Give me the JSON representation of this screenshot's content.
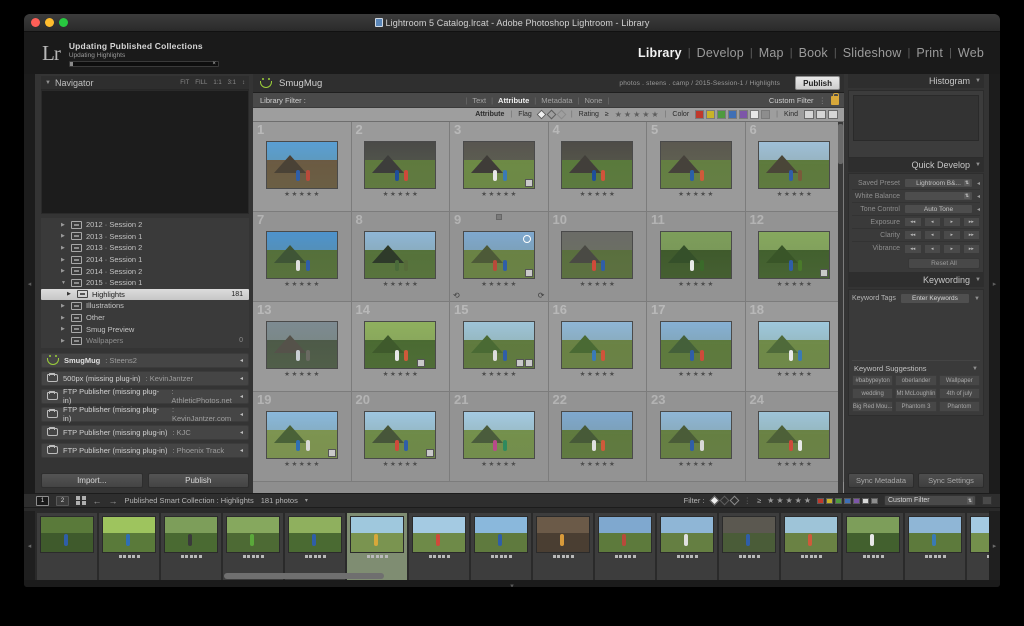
{
  "window": {
    "title": "Lightroom 5 Catalog.lrcat - Adobe Photoshop Lightroom - Library",
    "traffic": [
      "close",
      "minimize",
      "maximize"
    ]
  },
  "header": {
    "logo": "Lr",
    "progress": {
      "title": "Updating Published Collections",
      "subtitle": "Updating Highlights",
      "cancel": "×",
      "percent": 3
    },
    "modules": [
      {
        "label": "Library",
        "active": true
      },
      {
        "label": "Develop",
        "active": false
      },
      {
        "label": "Map",
        "active": false
      },
      {
        "label": "Book",
        "active": false
      },
      {
        "label": "Slideshow",
        "active": false
      },
      {
        "label": "Print",
        "active": false
      },
      {
        "label": "Web",
        "active": false
      }
    ],
    "separator": "|"
  },
  "left_panel": {
    "navigator": {
      "title": "Navigator",
      "zoom_levels": [
        "FIT",
        "FILL",
        "1:1",
        "3:1"
      ],
      "caret": "↕"
    },
    "tree": [
      {
        "label": "2012 · Session 2",
        "count": "",
        "selected": false
      },
      {
        "label": "2013 · Session 1",
        "count": "",
        "selected": false
      },
      {
        "label": "2013 · Session 2",
        "count": "",
        "selected": false
      },
      {
        "label": "2014 · Session 1",
        "count": "",
        "selected": false
      },
      {
        "label": "2014 · Session 2",
        "count": "",
        "selected": false
      },
      {
        "label": "2015 · Session 1",
        "count": "",
        "selected": false,
        "expanded": true
      },
      {
        "label": "Highlights",
        "count": "181",
        "selected": true,
        "child": true
      },
      {
        "label": "Illustrations",
        "count": "",
        "selected": false
      },
      {
        "label": "Other",
        "count": "",
        "selected": false
      },
      {
        "label": "Smug Preview",
        "count": "",
        "selected": false
      },
      {
        "label": "Wallpapers",
        "count": "0",
        "selected": false,
        "dim": true
      }
    ],
    "publish_services": [
      {
        "name": "SmugMug",
        "account": "Steens2",
        "icon": "smugmug-icon",
        "active": true
      },
      {
        "name": "500px (missing plug-in)",
        "account": "KevinJantzer",
        "icon": "folder-icon"
      },
      {
        "name": "FTP Publisher (missing plug-in)",
        "account": "AthleticPhotos.net",
        "icon": "folder-icon"
      },
      {
        "name": "FTP Publisher (missing plug-in)",
        "account": "KevinJantzer.com",
        "icon": "folder-icon"
      },
      {
        "name": "FTP Publisher (missing plug-in)",
        "account": "KJC",
        "icon": "folder-icon"
      },
      {
        "name": "FTP Publisher (missing plug-in)",
        "account": "Phoenix Track",
        "icon": "folder-icon"
      }
    ],
    "buttons": {
      "import": "Import...",
      "publish": "Publish"
    }
  },
  "content": {
    "service_title": "SmugMug",
    "breadcrumb": "photos . steens . camp / 2015-Session-1 / Highlights",
    "publish_button": "Publish",
    "library_filter": {
      "label": "Library Filter :",
      "tabs": [
        {
          "label": "Text",
          "active": false
        },
        {
          "label": "Attribute",
          "active": true
        },
        {
          "label": "Metadata",
          "active": false
        },
        {
          "label": "None",
          "active": false
        }
      ],
      "custom_filter": "Custom Filter",
      "lock_icon": "lock-icon"
    },
    "attribute_row": {
      "label": "Attribute",
      "flag_label": "Flag",
      "rating_label": "Rating",
      "rating_operator": "≥",
      "rating_stars": 5,
      "color_label": "Color",
      "colors": [
        "#c0392b",
        "#c9b328",
        "#4e9a3f",
        "#3f6fb5",
        "#7d56a8",
        "#e8e8e8",
        "#8d8d8d"
      ],
      "kind_label": "Kind"
    }
  },
  "grid": {
    "columns": 6,
    "rows": 4,
    "cells": [
      {
        "n": "1",
        "stars": 5,
        "sky": "#5a9fd4",
        "gnd": "#6b5a42",
        "pk": "#4a4236",
        "figA": "#2f5ea8",
        "figB": "#b84a3a",
        "crop": false,
        "dev": false
      },
      {
        "n": "2",
        "stars": 5,
        "sky": "#4a4a48",
        "gnd": "#5f7a3e",
        "pk": "#3d3d3b",
        "figA": "#1f4f9a",
        "figB": "#cf4a3a",
        "crop": false,
        "dev": false
      },
      {
        "n": "3",
        "stars": 5,
        "sky": "#585550",
        "gnd": "#6d8a45",
        "pk": "#3f3c38",
        "figA": "#e8e8e8",
        "figB": "#3a7ab5",
        "crop": true,
        "dev": false
      },
      {
        "n": "4",
        "stars": 5,
        "sky": "#4e4b47",
        "gnd": "#5a7a3c",
        "pk": "#423f3a",
        "figA": "#1f4f9a",
        "figB": "#d0543a",
        "crop": false,
        "dev": false
      },
      {
        "n": "5",
        "stars": 5,
        "sky": "#5b5850",
        "gnd": "#647f42",
        "pk": "#46423b",
        "figA": "#2a5fa8",
        "figB": "#cf5a3a",
        "crop": false,
        "dev": false
      },
      {
        "n": "6",
        "stars": 5,
        "sky": "#9fbfd8",
        "gnd": "#5d7a3c",
        "pk": "#4a4638",
        "figA": "#2f5ea8",
        "figB": "#7a5a3a",
        "crop": false,
        "dev": false
      },
      {
        "n": "7",
        "stars": 5,
        "sky": "#4e93cd",
        "gnd": "#55703a",
        "pk": "#3f5536",
        "figA": "#e0e0e0",
        "figB": "#2f5ea8",
        "crop": false,
        "dev": false
      },
      {
        "n": "8",
        "stars": 5,
        "sky": "#8fb6d6",
        "gnd": "#55723a",
        "pk": "#2e3a2a",
        "figA": "#4a6a3a",
        "figB": "#566b3a",
        "crop": false,
        "dev": false
      },
      {
        "n": "9",
        "stars": 5,
        "sky": "#7fa8cf",
        "gnd": "#6a8244",
        "pk": "#4d5a38",
        "figA": "#b84a3a",
        "figB": "#2f5ea8",
        "crop": true,
        "dev": false,
        "flag": true,
        "circle": true,
        "corners": true
      },
      {
        "n": "10",
        "stars": 5,
        "sky": "#6b6b67",
        "gnd": "#5a6f3e",
        "pk": "#4a4a44",
        "figA": "#cf4a3a",
        "figB": "#2f5ea8",
        "crop": false,
        "dev": false
      },
      {
        "n": "11",
        "stars": 5,
        "sky": "#7d9e5a",
        "gnd": "#3f5a2c",
        "pk": "#35502a",
        "figA": "#e8e8e8",
        "figB": "#3a6a2a",
        "crop": false,
        "dev": false
      },
      {
        "n": "12",
        "stars": 5,
        "sky": "#86a85e",
        "gnd": "#42602e",
        "pk": "#395528",
        "figA": "#2f5ea8",
        "figB": "#4a7a2a",
        "crop": true,
        "dev": false
      },
      {
        "n": "13",
        "stars": 5,
        "sky": "#7d8a92",
        "gnd": "#4d5a48",
        "pk": "#55524a",
        "figA": "#c9cfd4",
        "figB": "#6a6a62",
        "crop": false,
        "dev": false
      },
      {
        "n": "14",
        "stars": 5,
        "sky": "#8fb05e",
        "gnd": "#4a6a32",
        "pk": "#3f5a2c",
        "figA": "#e8e8e8",
        "figB": "#cf5a3a",
        "crop": false,
        "dev": true
      },
      {
        "n": "15",
        "stars": 5,
        "sky": "#9ec4d8",
        "gnd": "#5f7a3e",
        "pk": "#4a6a34",
        "figA": "#dcdcdc",
        "figB": "#2f5ea8",
        "crop": true,
        "dev": true
      },
      {
        "n": "16",
        "stars": 5,
        "sky": "#8fb6d6",
        "gnd": "#6a8244",
        "pk": "#4a6a34",
        "figA": "#3a7ab5",
        "figB": "#d0543a",
        "crop": false,
        "dev": false
      },
      {
        "n": "17",
        "stars": 5,
        "sky": "#86b0d4",
        "gnd": "#5d7a3c",
        "pk": "#44603a",
        "figA": "#2f5ea8",
        "figB": "#cf4a3a",
        "crop": false,
        "dev": false
      },
      {
        "n": "18",
        "stars": 5,
        "sky": "#9fc8dd",
        "gnd": "#6f8a48",
        "pk": "#4f6a3a",
        "figA": "#e8e8e8",
        "figB": "#3a7ab5",
        "crop": false,
        "dev": false
      },
      {
        "n": "19",
        "stars": 5,
        "sky": "#8ab8dc",
        "gnd": "#7d9450",
        "pk": "#4a6238",
        "figA": "#2f6fb5",
        "figB": "#d8d8d8",
        "crop": true,
        "dev": false
      },
      {
        "n": "20",
        "stars": 5,
        "sky": "#9ec6e0",
        "gnd": "#6e8a48",
        "pk": "#47563a",
        "figA": "#cf4a3a",
        "figB": "#2f5ea8",
        "crop": true,
        "dev": false
      },
      {
        "n": "21",
        "stars": 5,
        "sky": "#a4cae2",
        "gnd": "#74904c",
        "pk": "#4a5c3c",
        "figA": "#b84a8a",
        "figB": "#2f8a5e",
        "crop": false,
        "dev": false
      },
      {
        "n": "22",
        "stars": 5,
        "sky": "#7fa8cf",
        "gnd": "#5f7a3e",
        "pk": "#475a38",
        "figA": "#e0e0e0",
        "figB": "#cf5a3a",
        "crop": false,
        "dev": false
      },
      {
        "n": "23",
        "stars": 5,
        "sky": "#8fb6d6",
        "gnd": "#657f42",
        "pk": "#4a5c38",
        "figA": "#2f5ea8",
        "figB": "#d8d8d8",
        "crop": false,
        "dev": false
      },
      {
        "n": "24",
        "stars": 5,
        "sky": "#9ec4d8",
        "gnd": "#6a8244",
        "pk": "#4d6038",
        "figA": "#cf4a3a",
        "figB": "#e8e8e8",
        "crop": false,
        "dev": false
      }
    ]
  },
  "right_panel": {
    "histogram": {
      "title": "Histogram"
    },
    "quick_develop": {
      "title": "Quick Develop",
      "rows": [
        {
          "label": "Saved Preset",
          "type": "select",
          "value": "Lightroom B&..."
        },
        {
          "label": "White Balance",
          "type": "select",
          "value": ""
        },
        {
          "label": "Tone Control",
          "type": "button",
          "value": "Auto Tone"
        },
        {
          "label": "Exposure",
          "type": "steps"
        },
        {
          "label": "Clarity",
          "type": "steps"
        },
        {
          "label": "Vibrance",
          "type": "steps"
        }
      ],
      "reset": "Reset All",
      "step_marks": [
        "◂◂",
        "◂",
        "▸",
        "▸▸"
      ]
    },
    "keywording": {
      "title": "Keywording",
      "tags_label": "Keyword Tags",
      "tags_placeholder": "Enter Keywords",
      "suggestions_title": "Keyword Suggestions",
      "suggestions": [
        "#babypeyton",
        "oberlander",
        "Wallpaper",
        "wedding",
        "Mt McLoughlin",
        "4th of july",
        "Big Red Mou...",
        "Phantom 3",
        "Phantom"
      ]
    },
    "sync": {
      "metadata": "Sync Metadata",
      "settings": "Sync Settings"
    }
  },
  "toolbar": {
    "page_buttons": [
      "1",
      "2"
    ],
    "view_icon": "grid-view-icon",
    "prev_icon": "arrow-left-icon",
    "next_icon": "arrow-right-icon",
    "source": "Published Smart Collection : Highlights",
    "photo_count": "181 photos",
    "filter_label": "Filter :",
    "custom_filter": "Custom Filter",
    "filter_colors": [
      "#c0392b",
      "#c9b328",
      "#4e9a3f",
      "#3f6fb5",
      "#7d56a8",
      "#d8d8d8",
      "#8d8d8d"
    ]
  },
  "filmstrip": {
    "thumbs": [
      {
        "stars": 0,
        "sky": "#5a7a3a",
        "gnd": "#3f5a2c",
        "figA": "#2f5ea8",
        "sel": false
      },
      {
        "stars": 5,
        "sky": "#9ec45e",
        "gnd": "#5a7a3a",
        "figA": "#2f6fb5",
        "sel": false
      },
      {
        "stars": 5,
        "sky": "#7d9e5a",
        "gnd": "#4a6a32",
        "figA": "#3a3a3a",
        "sel": false
      },
      {
        "stars": 5,
        "sky": "#86a85e",
        "gnd": "#4d6a34",
        "figA": "#5aa83a",
        "sel": false
      },
      {
        "stars": 5,
        "sky": "#8fb05e",
        "gnd": "#4a6a32",
        "figA": "#2f5ea8",
        "sel": false
      },
      {
        "stars": 5,
        "sky": "#9fc8dd",
        "gnd": "#7a9450",
        "figA": "#d8a83a",
        "sel": true
      },
      {
        "stars": 5,
        "sky": "#a4cae2",
        "gnd": "#6e8a48",
        "figA": "#cf4a3a",
        "sel": false
      },
      {
        "stars": 5,
        "sky": "#8ab8dc",
        "gnd": "#5f7a3e",
        "figA": "#2f5ea8",
        "sel": false
      },
      {
        "stars": 5,
        "sky": "#6b5a48",
        "gnd": "#4a3e32",
        "figA": "#d89a3a",
        "sel": false
      },
      {
        "stars": 5,
        "sky": "#7fa8cf",
        "gnd": "#5d7a3c",
        "figA": "#b84a3a",
        "sel": false
      },
      {
        "stars": 5,
        "sky": "#8fb6d6",
        "gnd": "#657f42",
        "figA": "#e0e0e0",
        "sel": false
      },
      {
        "stars": 5,
        "sky": "#5b5850",
        "gnd": "#4a5c38",
        "figA": "#2f5ea8",
        "sel": false
      },
      {
        "stars": 5,
        "sky": "#9ec4d8",
        "gnd": "#6a8244",
        "figA": "#cf5a3a",
        "sel": false
      },
      {
        "stars": 5,
        "sky": "#7d9e5a",
        "gnd": "#42602e",
        "figA": "#e8e8e8",
        "sel": false
      },
      {
        "stars": 5,
        "sky": "#8fb6d6",
        "gnd": "#5d7a3c",
        "figA": "#3a7ab5",
        "sel": false
      },
      {
        "stars": 5,
        "sky": "#a4cae2",
        "gnd": "#74904c",
        "figA": "#2f8a5e",
        "sel": false
      }
    ]
  }
}
